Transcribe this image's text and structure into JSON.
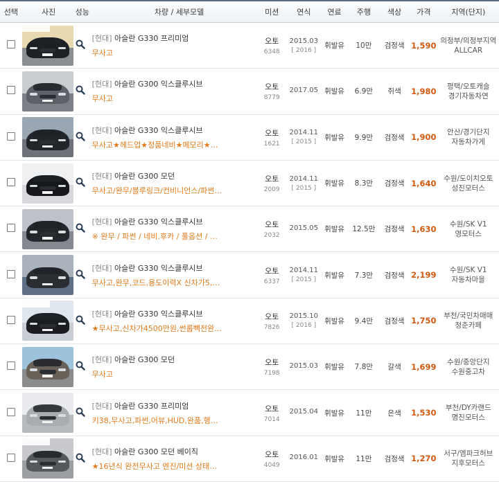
{
  "headers": {
    "select": "선택",
    "photo": "사진",
    "spec": "성능",
    "model": "차량 / 세부모델",
    "trans": "미션",
    "year": "연식",
    "fuel": "연료",
    "km": "주행",
    "color": "색상",
    "price": "가격",
    "region": "지역(단지)"
  },
  "rows": [
    {
      "brand": "[현대]",
      "model": "아슬란 G330 프리미엄",
      "sub": "무사고",
      "trans": "오토",
      "trans_code": "6348",
      "year": "2015.03",
      "year_sub": "[ 2016 ]",
      "fuel": "휘발유",
      "km": "10만",
      "color": "검정색",
      "price": "1,590",
      "region1": "의정부/의정부지역",
      "region2": "ALLCAR"
    },
    {
      "brand": "[현대]",
      "model": "아슬란 G300 익스클루시브",
      "sub": "무사고",
      "trans": "오토",
      "trans_code": "8779",
      "year": "2017.05",
      "year_sub": "",
      "fuel": "휘발유",
      "km": "6.9만",
      "color": "쥐색",
      "price": "1,980",
      "region1": "평택/오토캐슬",
      "region2": "경기자동차연"
    },
    {
      "brand": "[현대]",
      "model": "아슬란 G330 익스클루시브",
      "sub": "무사고★헤드업★정품네비★메모리★듀얼통...",
      "trans": "오토",
      "trans_code": "1621",
      "year": "2014.11",
      "year_sub": "[ 2015 ]",
      "fuel": "휘발유",
      "km": "9.9만",
      "color": "검정색",
      "price": "1,900",
      "region1": "안산/경기단지",
      "region2": "자동차가게"
    },
    {
      "brand": "[현대]",
      "model": "아슬란 G300 모던",
      "sub": "무사고/완무/블루링크/컨비니언스/파썬/용...",
      "trans": "오토",
      "trans_code": "2009",
      "year": "2014.11",
      "year_sub": "[ 2015 ]",
      "fuel": "휘발유",
      "km": "8.3만",
      "color": "검정색",
      "price": "1,640",
      "region1": "수원/도이치오토",
      "region2": "성진모터스"
    },
    {
      "brand": "[현대]",
      "model": "아슬란 G330 익스클루시브",
      "sub": "※ 완무 / 파썬 / 네비.후카 / 풀옵션 / 코...",
      "trans": "오토",
      "trans_code": "2032",
      "year": "2015.05",
      "year_sub": "",
      "fuel": "휘발유",
      "km": "12.5만",
      "color": "검정색",
      "price": "1,630",
      "region1": "수원/SK V1",
      "region2": "영모터스"
    },
    {
      "brand": "[현대]",
      "model": "아슬란 G330 익스클루시브",
      "sub": "무사고,완무,코드,용도이력X 신차가5,065...",
      "trans": "오토",
      "trans_code": "6337",
      "year": "2014.11",
      "year_sub": "[ 2015 ]",
      "fuel": "휘발유",
      "km": "7.3만",
      "color": "검정색",
      "price": "2,199",
      "region1": "수원/SK V1",
      "region2": "자동차마을"
    },
    {
      "brand": "[현대]",
      "model": "아슬란 G330 익스클루시브",
      "sub": "★무사고,신차가4500만원,썬룹빽전완,전...",
      "trans": "오토",
      "trans_code": "7826",
      "year": "2015.10",
      "year_sub": "[ 2016 ]",
      "fuel": "휘발유",
      "km": "9.4만",
      "color": "검정색",
      "price": "1,750",
      "region1": "부천/국민차매매",
      "region2": "청춘카페"
    },
    {
      "brand": "[현대]",
      "model": "아슬란 G300 모던",
      "sub": "무사고",
      "trans": "오토",
      "trans_code": "7198",
      "year": "2015.03",
      "year_sub": "",
      "fuel": "휘발유",
      "km": "7.8만",
      "color": "갈색",
      "price": "1,699",
      "region1": "수원/중앙단지",
      "region2": "수원중고차"
    },
    {
      "brand": "[현대]",
      "model": "아슬란 G330 프리미엄",
      "sub": "키38,무사고,파썬,어뷰,HUD,완품,행직관리...",
      "trans": "오토",
      "trans_code": "7014",
      "year": "2015.04",
      "year_sub": "",
      "fuel": "휘발유",
      "km": "11만",
      "color": "은색",
      "price": "1,530",
      "region1": "부천/DY카랜드",
      "region2": "명진모터스"
    },
    {
      "brand": "[현대]",
      "model": "아슬란 G300 모던 베이직",
      "sub": "★16년식 완전무사고 엔진/미션 상태양호 ...",
      "trans": "오토",
      "trans_code": "4049",
      "year": "2016.01",
      "year_sub": "",
      "fuel": "휘발유",
      "km": "11만",
      "color": "검정색",
      "price": "1,270",
      "region1": "서구/엠파크허브",
      "region2": "지후모터스"
    }
  ],
  "photo_palettes": [
    {
      "sky": "#e8d9b0",
      "ground": "#8b8e93",
      "car": "#1d2024",
      "banner": true
    },
    {
      "sky": "#c9cdd2",
      "ground": "#7c8086",
      "car": "#5c6167",
      "banner": false
    },
    {
      "sky": "#9aa7b3",
      "ground": "#6d7278",
      "car": "#222529",
      "banner": false
    },
    {
      "sky": "#eef0f2",
      "ground": "#d7d9dc",
      "car": "#16181b",
      "banner": false
    },
    {
      "sky": "#bcc2c8",
      "ground": "#85898f",
      "car": "#23262a",
      "banner": false
    },
    {
      "sky": "#aab3bb",
      "ground": "#5f6f85",
      "car": "#2a2d31",
      "banner": false
    },
    {
      "sky": "#dfe6ee",
      "ground": "#c9ced4",
      "car": "#1b1d21",
      "banner": true
    },
    {
      "sky": "#9dc2dc",
      "ground": "#8a8c8e",
      "car": "#6a6259",
      "banner": false
    },
    {
      "sky": "#e9ebee",
      "ground": "#b7bbc0",
      "car": "#a9adb2",
      "banner": false
    },
    {
      "sky": "#c7c9cc",
      "ground": "#9b9ea2",
      "car": "#55595e",
      "banner": true
    }
  ]
}
